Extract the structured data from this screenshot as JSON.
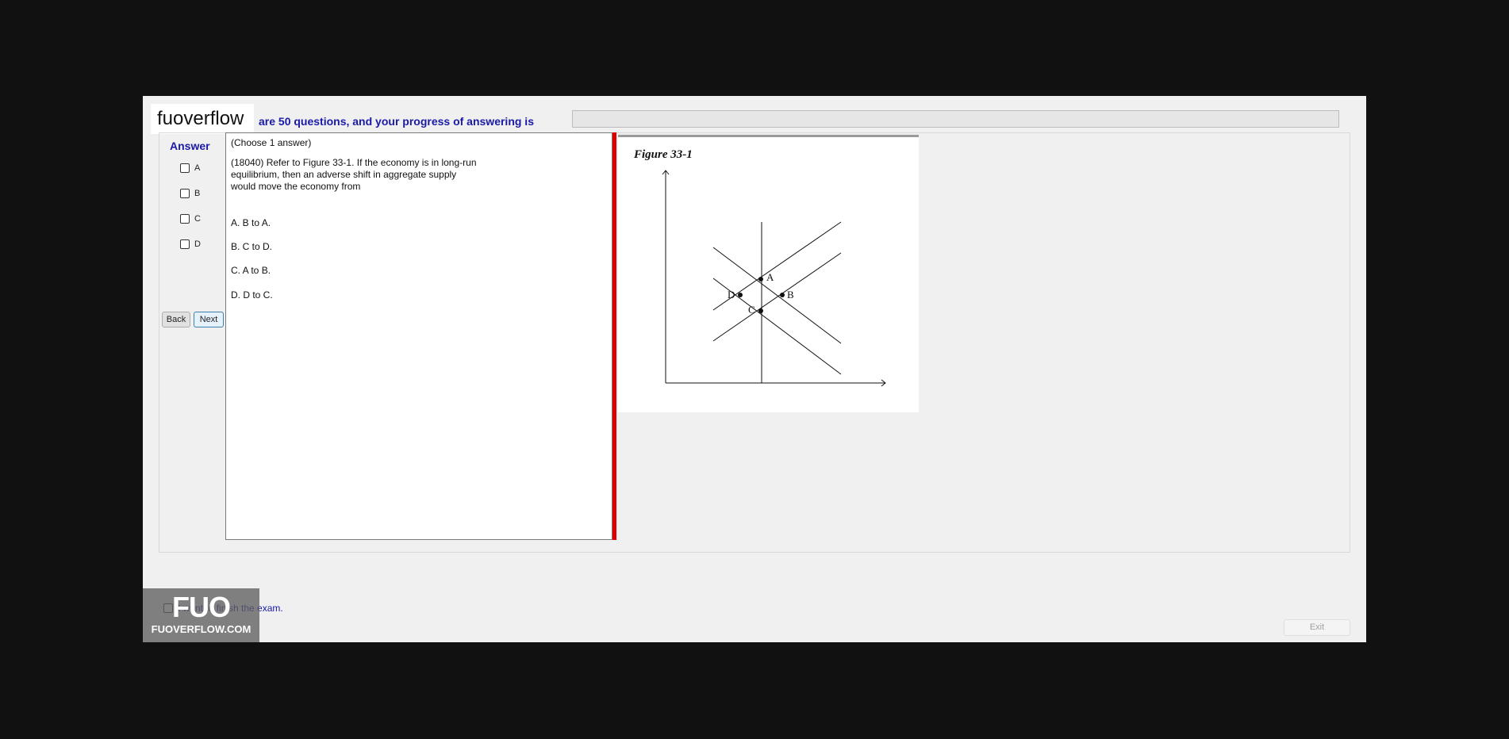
{
  "header": {
    "progress_text": "are 50 questions, and your progress of answering is",
    "progress_percent": 0
  },
  "logo": {
    "text": "fuoverflow"
  },
  "answer": {
    "title": "Answer",
    "options": [
      "A",
      "B",
      "C",
      "D"
    ]
  },
  "nav": {
    "back_label": "Back",
    "next_label": "Next"
  },
  "question": {
    "choose_text": "(Choose 1 answer)",
    "line1": "(18040)  Refer to Figure 33-1. If the economy is in long-run",
    "line2": "equilibrium, then an adverse shift in aggregate supply",
    "line3": "would move the economy from",
    "choices": [
      "A.  B to A.",
      "B.  C to D.",
      "C.  A to B.",
      "D.  D to C."
    ]
  },
  "figure": {
    "title": "Figure 33-1",
    "points": [
      "A",
      "B",
      "C",
      "D"
    ]
  },
  "footer": {
    "finish_label": "I want to finish the exam.",
    "exit_label": "Exit"
  },
  "watermark": {
    "brand": "FUO",
    "site": "FUOVERFLOW.COM"
  },
  "colors": {
    "accent": "#1a1aa6",
    "splitter": "#e00000",
    "background": "#111111",
    "progress_fill": "#06b025"
  }
}
